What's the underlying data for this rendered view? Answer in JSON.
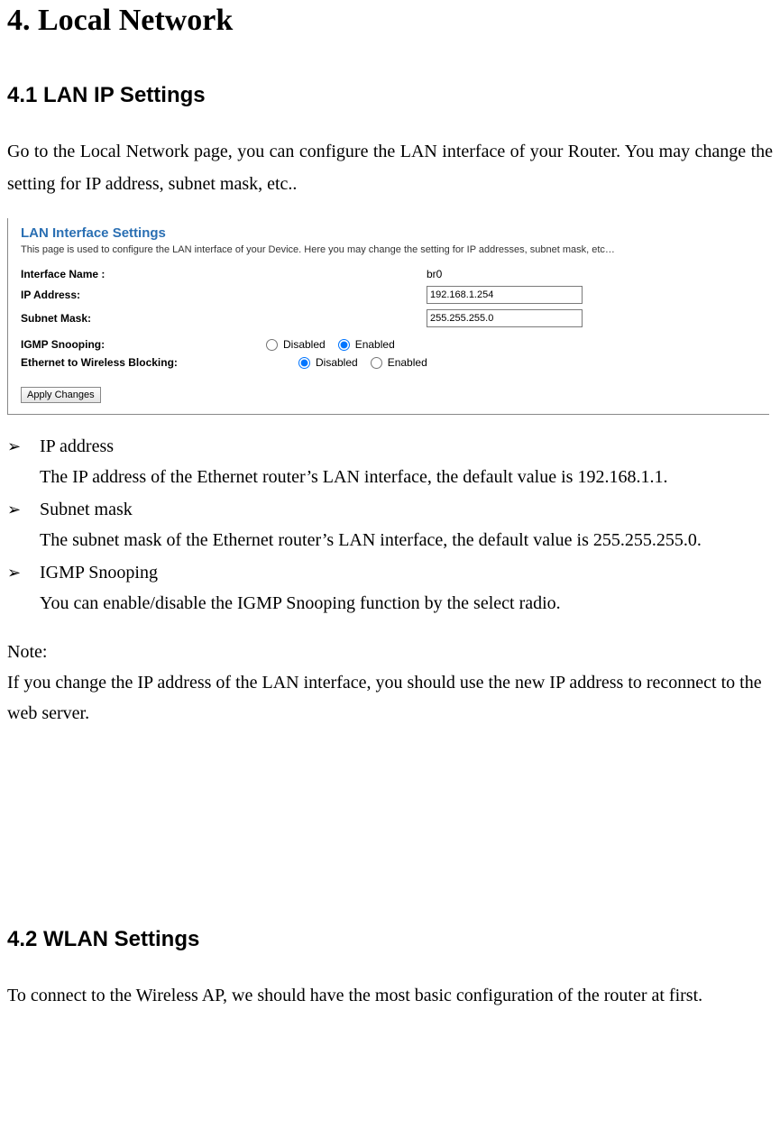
{
  "h1": "4. Local Network",
  "section1": {
    "heading": "4.1 LAN IP Settings",
    "intro": "Go to the Local Network page, you can configure the LAN interface of your Router. You may change the setting for IP address, subnet mask, etc.."
  },
  "screenshot": {
    "title": "LAN Interface Settings",
    "description": "This page is used to configure the LAN interface of your Device. Here you may change the setting for IP addresses, subnet mask, etc…",
    "interface_name_label": "Interface Name :",
    "interface_name_value": "br0",
    "ip_address_label": "IP Address:",
    "ip_address_value": "192.168.1.254",
    "subnet_mask_label": "Subnet Mask:",
    "subnet_mask_value": "255.255.255.0",
    "igmp_label": "IGMP Snooping:",
    "ew_label": "Ethernet to Wireless Blocking:",
    "disabled_label": "Disabled",
    "enabled_label": "Enabled",
    "apply_label": "Apply Changes"
  },
  "bullets": [
    {
      "title": "IP address",
      "desc": "The IP address of the Ethernet router’s LAN interface, the default value is 192.168.1.1."
    },
    {
      "title": "Subnet mask",
      "desc": "The subnet mask of the Ethernet router’s LAN interface, the default value is 255.255.255.0."
    },
    {
      "title": "IGMP Snooping",
      "desc": "You can enable/disable the IGMP Snooping function by the select radio."
    }
  ],
  "note": {
    "label": "Note:",
    "text": "If you change the IP address of the LAN interface, you should use the new IP address to reconnect to the web server."
  },
  "section2": {
    "heading": "4.2 WLAN Settings",
    "intro": "To connect to the Wireless AP, we should have the most basic configuration of the router at first."
  },
  "arrow_glyph": "➢"
}
